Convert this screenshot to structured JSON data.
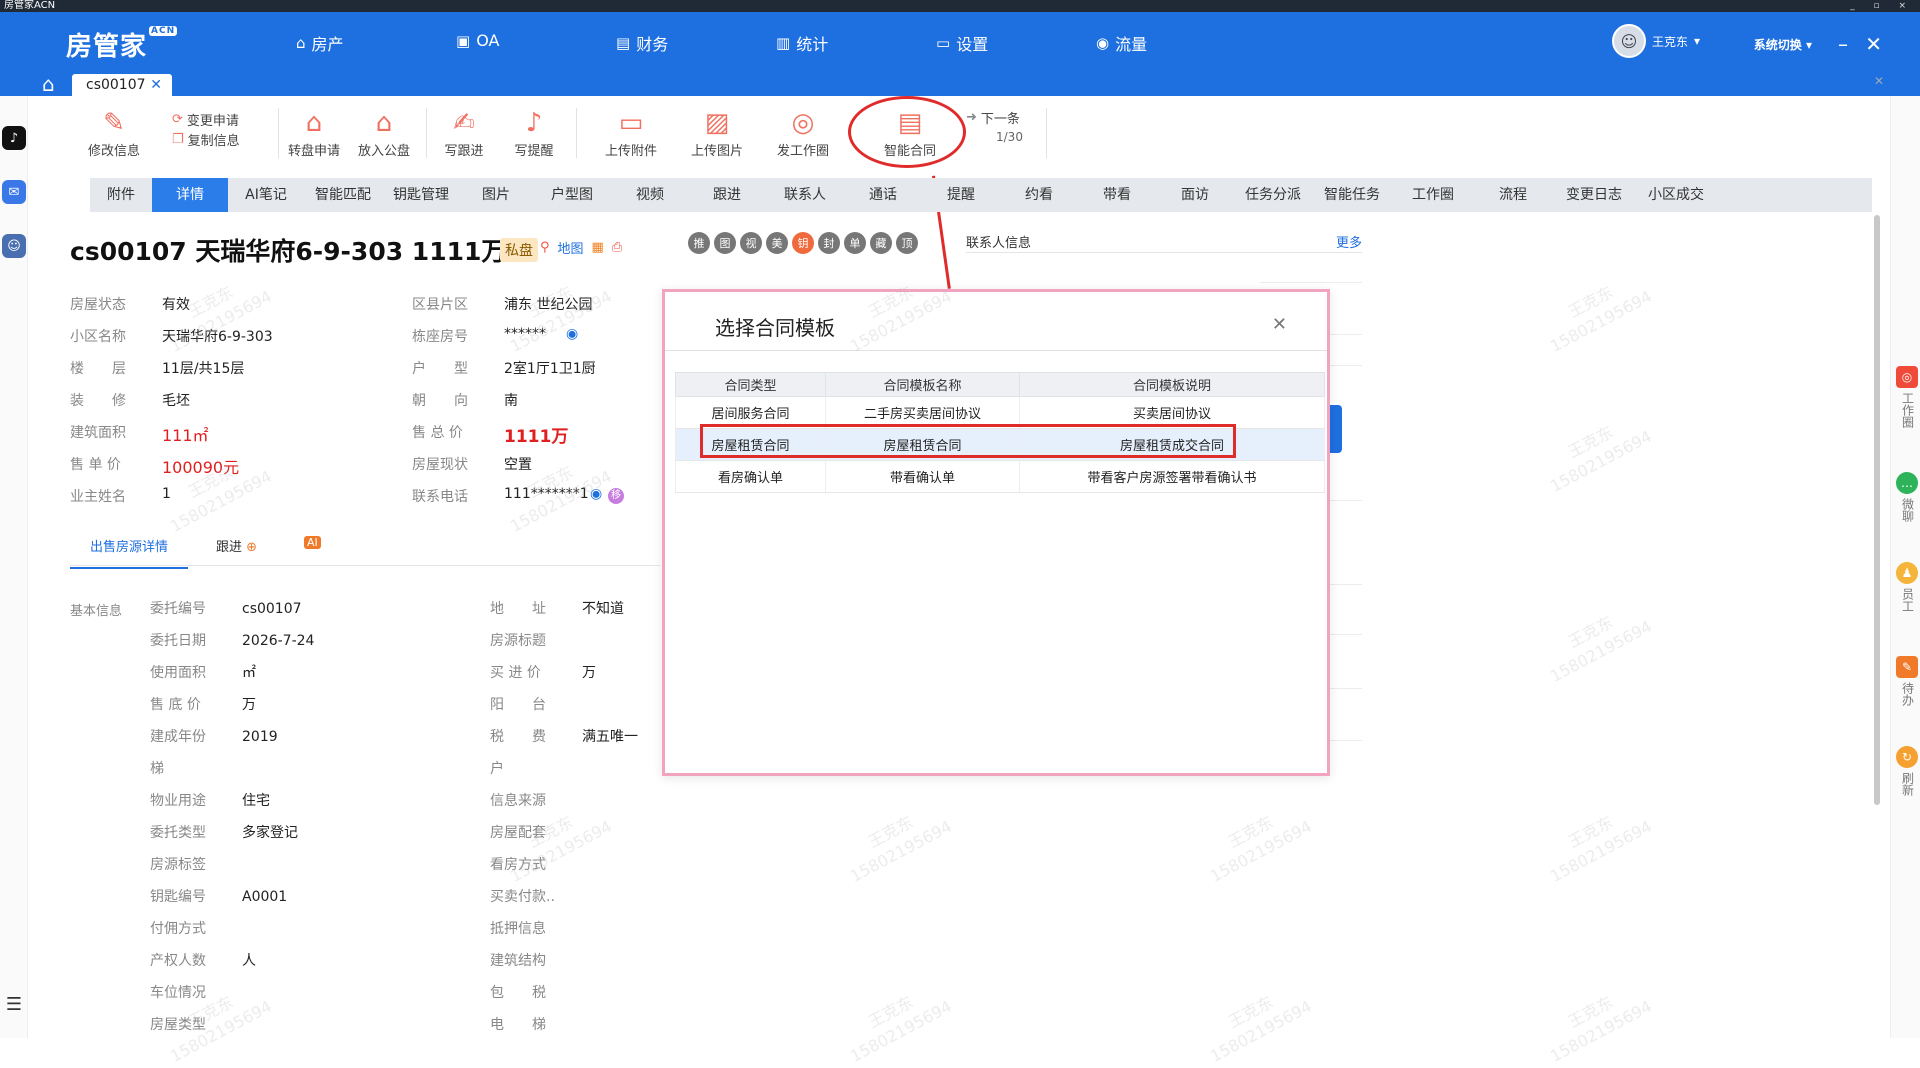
{
  "window": {
    "title": "房管家ACN",
    "controls": "_ ▫ ×"
  },
  "app": {
    "logo": "房管家",
    "logo_badge": "ACN"
  },
  "nav": [
    {
      "label": "房产",
      "icon": "home-icon"
    },
    {
      "label": "OA",
      "icon": "briefcase-icon"
    },
    {
      "label": "财务",
      "icon": "wallet-icon"
    },
    {
      "label": "统计",
      "icon": "chart-icon"
    },
    {
      "label": "设置",
      "icon": "monitor-icon"
    },
    {
      "label": "流量",
      "icon": "gauge-icon"
    }
  ],
  "user": {
    "name": "王克东",
    "system_switch": "系统切换"
  },
  "tabs": {
    "doc_tab": "cs00107"
  },
  "toolbar": {
    "edit_info": "修改信息",
    "change_request": "变更申请",
    "copy_info": "复制信息",
    "transfer_request": "转盘申请",
    "put_public": "放入公盘",
    "write_followup": "写跟进",
    "write_reminder": "写提醒",
    "upload_attachment": "上传附件",
    "upload_image": "上传图片",
    "post_work": "发工作圈",
    "smart_contract": "智能合同",
    "next": "下一条",
    "next_count": "1/30"
  },
  "detail_tabs": [
    "附件",
    "详情",
    "AI笔记",
    "智能匹配",
    "钥匙管理",
    "图片",
    "户型图",
    "视频",
    "跟进",
    "联系人",
    "通话",
    "提醒",
    "约看",
    "带看",
    "面访",
    "任务分派",
    "智能任务",
    "工作圈",
    "流程",
    "变更日志",
    "小区成交"
  ],
  "house": {
    "title": "cs00107 天瑞华府6-9-303 1111万",
    "private_badge": "私盘",
    "map_label": "地图",
    "circle_badges": [
      "推",
      "图",
      "视",
      "美",
      "钥",
      "封",
      "单",
      "藏",
      "顶"
    ]
  },
  "info_left": [
    {
      "label": "房屋状态",
      "value": "有效"
    },
    {
      "label": "小区名称",
      "value": "天瑞华府6-9-303"
    },
    {
      "label": "楼　　层",
      "value": "11层/共15层"
    },
    {
      "label": "装　　修",
      "value": "毛坯"
    },
    {
      "label": "建筑面积",
      "value": "111㎡"
    },
    {
      "label": "售 单 价",
      "value": "100090元"
    },
    {
      "label": "业主姓名",
      "value": "1"
    }
  ],
  "info_right": [
    {
      "label": "区县片区",
      "value": "浦东 世纪公园"
    },
    {
      "label": "栋座房号",
      "value": "******"
    },
    {
      "label": "户　　型",
      "value": "2室1厅1卫1厨"
    },
    {
      "label": "朝　　向",
      "value": "南"
    },
    {
      "label": "售 总 价",
      "value": "1111万"
    },
    {
      "label": "房屋现状",
      "value": "空置"
    },
    {
      "label": "联系电话",
      "value": "111*******1"
    }
  ],
  "sub_tabs": {
    "sale_detail": "出售房源详情",
    "followup": "跟进",
    "ai": "AI"
  },
  "basic": {
    "section_label": "基本信息",
    "left": [
      {
        "label": "委托编号",
        "value": "cs00107"
      },
      {
        "label": "委托日期",
        "value": "2026-7-24"
      },
      {
        "label": "使用面积",
        "value": "㎡"
      },
      {
        "label": "售 底 价",
        "value": "万"
      },
      {
        "label": "建成年份",
        "value": "2019"
      },
      {
        "label": "梯",
        "value": ""
      },
      {
        "label": "物业用途",
        "value": "住宅"
      },
      {
        "label": "委托类型",
        "value": "多家登记"
      },
      {
        "label": "房源标签",
        "value": ""
      },
      {
        "label": "钥匙编号",
        "value": "A0001"
      },
      {
        "label": "付佣方式",
        "value": ""
      },
      {
        "label": "产权人数",
        "value": "人"
      },
      {
        "label": "车位情况",
        "value": ""
      },
      {
        "label": "房屋类型",
        "value": ""
      }
    ],
    "right": [
      {
        "label": "地　　址",
        "value": "不知道"
      },
      {
        "label": "房源标题",
        "value": ""
      },
      {
        "label": "买 进 价",
        "value": "万"
      },
      {
        "label": "阳　　台",
        "value": ""
      },
      {
        "label": "税　　费",
        "value": "满五唯一"
      },
      {
        "label": "户",
        "value": ""
      },
      {
        "label": "信息来源",
        "value": ""
      },
      {
        "label": "房屋配套",
        "value": ""
      },
      {
        "label": "看房方式",
        "value": ""
      },
      {
        "label": "买卖付款..",
        "value": ""
      },
      {
        "label": "抵押信息",
        "value": ""
      },
      {
        "label": "建筑结构",
        "value": ""
      },
      {
        "label": "包　　税",
        "value": ""
      },
      {
        "label": "电　　梯",
        "value": ""
      }
    ]
  },
  "contact": {
    "title": "联系人信息",
    "more": "更多"
  },
  "modal": {
    "title": "选择合同模板",
    "columns": [
      "合同类型",
      "合同模板名称",
      "合同模板说明"
    ],
    "rows": [
      [
        "居间服务合同",
        "二手房买卖居间协议",
        "买卖居间协议"
      ],
      [
        "房屋租赁合同",
        "房屋租赁合同",
        "房屋租赁成交合同"
      ],
      [
        "看房确认单",
        "带看确认单",
        "带看客户房源签署带看确认书"
      ]
    ]
  },
  "right_sidebar": [
    {
      "label": "工作圈",
      "icon": "work-circle-icon",
      "color": "#ef4a3a"
    },
    {
      "label": "微聊",
      "icon": "chat-icon",
      "color": "#2fb35a"
    },
    {
      "label": "员工",
      "icon": "staff-icon",
      "color": "#f5b43a"
    },
    {
      "label": "待办",
      "icon": "todo-icon",
      "color": "#f07a2a"
    },
    {
      "label": "刷新",
      "icon": "refresh-icon",
      "color": "#f5a030"
    }
  ],
  "watermark": {
    "name": "王克东",
    "phone": "15802195694"
  },
  "colors": {
    "brand_blue": "#1e6fe0",
    "accent_red": "#e02020",
    "modal_border": "#f2a3c0",
    "highlight_red": "#e02b2b"
  }
}
